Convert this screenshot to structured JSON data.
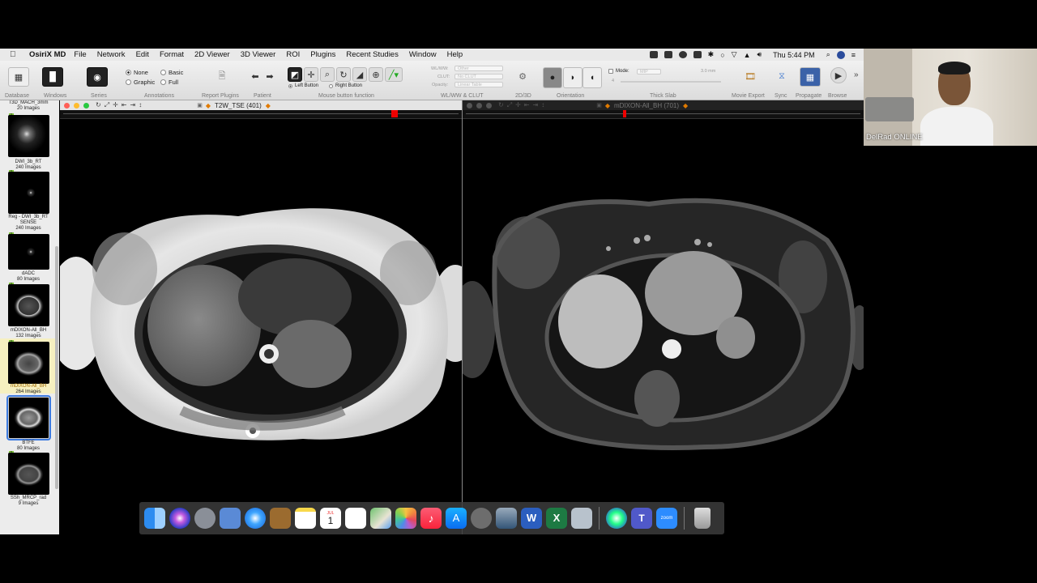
{
  "menubar": {
    "app_name": "OsiriX MD",
    "items": [
      "File",
      "Network",
      "Edit",
      "Format",
      "2D Viewer",
      "3D Viewer",
      "ROI",
      "Plugins",
      "Recent Studies",
      "Window",
      "Help"
    ],
    "clock": "Thu 5:44 PM"
  },
  "toolbar": {
    "labels": {
      "database": "Database",
      "windows": "Windows",
      "series": "Series",
      "annotations": "Annotations",
      "report_plugins": "Report Plugins",
      "patient": "Patient",
      "mouse_button_function": "Mouse button function",
      "wlww_clut": "WL/WW & CLUT",
      "twod_threed": "2D/3D",
      "orientation": "Orientation",
      "thick_slab": "Thick Slab",
      "movie_export": "Movie Export",
      "sync": "Sync",
      "propagate": "Propagate",
      "browse": "Browse"
    },
    "annotations": {
      "none": "None",
      "graphic": "Graphic",
      "basic": "Basic",
      "full": "Full",
      "selected": "None"
    },
    "mouse": {
      "left": "Left Button",
      "right": "Right Button"
    },
    "wlww": {
      "wlww_label": "WL/WW:",
      "wlww_value": "Other",
      "clut_label": "CLUT:",
      "clut_value": "No CLUT",
      "opacity_label": "Opacity:",
      "opacity_value": "Linear Table"
    },
    "thick_slab": {
      "mode_label": "Mode:",
      "mode_value": "MIP",
      "thickness": "3.0 mm",
      "count": "4"
    }
  },
  "sidebar": {
    "series": [
      {
        "name": "T3D_MACH_3mm",
        "images": "20 Images"
      },
      {
        "name": "DWI_3b_RT",
        "images": "240 Images"
      },
      {
        "name": "Reg - DWI_3b_RT SENSE",
        "images": "240 Images"
      },
      {
        "name": "dADC",
        "images": "80 Images"
      },
      {
        "name": "mDIXON-All_BH",
        "images": "132 Images"
      },
      {
        "name": "mDIXON-All_BH",
        "images": "264 Images"
      },
      {
        "name": "BTFE",
        "images": "80 Images"
      },
      {
        "name": "SSh_MRCP_rad",
        "images": "9 Images"
      }
    ]
  },
  "viewers": [
    {
      "title": "T2W_TSE (401)",
      "active": true
    },
    {
      "title": "mDIXON-All_BH (701)",
      "active": false
    }
  ],
  "dock": {
    "apps": [
      "finder-icon",
      "siri-icon",
      "launchpad-icon",
      "preview-icon",
      "safari-icon",
      "notefile-icon",
      "notes-icon",
      "calendar-icon",
      "reminders-icon",
      "maps-icon",
      "photos-icon",
      "music-icon",
      "app-store-icon",
      "system-preferences-icon",
      "osirix-icon",
      "word-icon",
      "excel-icon",
      "image-capture-icon",
      "browser-icon",
      "teams-icon",
      "zoom-icon",
      "trash-icon"
    ],
    "calendar_day": "1",
    "calendar_month": "JUL",
    "zoom_label": "zoom"
  },
  "webcam": {
    "name": "DelRad ONLINE"
  }
}
